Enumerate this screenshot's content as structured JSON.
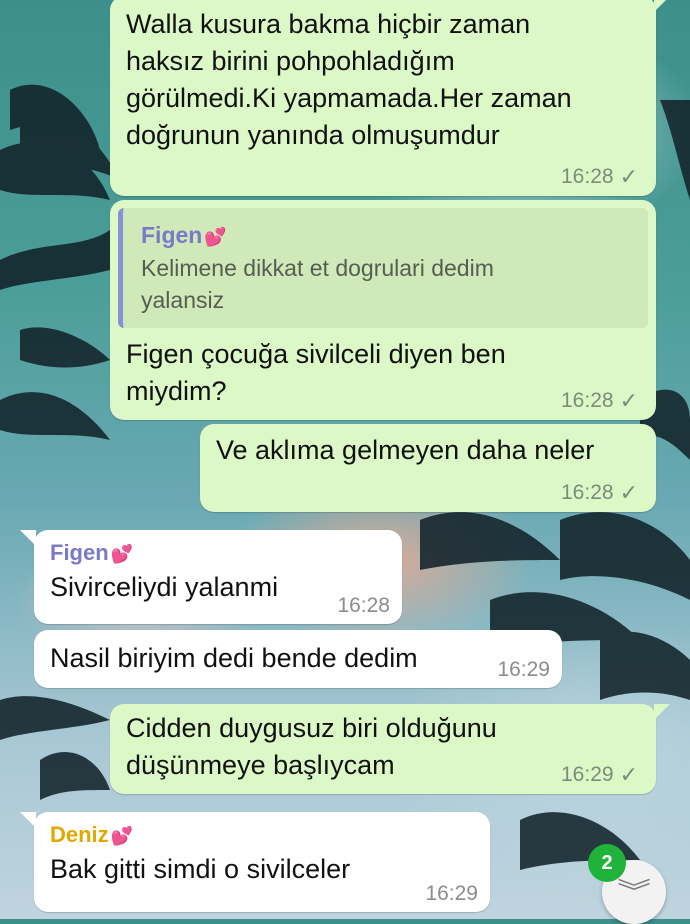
{
  "colors": {
    "outgoing_bubble": "#dcf8c6",
    "incoming_bubble": "#ffffff",
    "sender_figen": "#7b79c9",
    "sender_deniz": "#e0a800",
    "unread_badge": "#1fb33c"
  },
  "messages": [
    {
      "direction": "outgoing",
      "text": "Walla kusura bakma hiçbir zaman\nhaksız birini pohpohladığım\ngörülmedi.Ki yapmamada.Her zaman\ndoğrunun yanında olmuşumdur",
      "time": "16:28",
      "status_icon": "single-check"
    },
    {
      "direction": "outgoing",
      "reply_to": {
        "sender": "Figen",
        "text": "Kelimene dikkat et dogrulari dedim\nyalansiz"
      },
      "text": "Figen çocuğa sivilceli diyen ben\nmiydim?",
      "time": "16:28",
      "status_icon": "single-check"
    },
    {
      "direction": "outgoing",
      "text": "Ve aklıma gelmeyen daha neler",
      "time": "16:28",
      "status_icon": "single-check"
    },
    {
      "direction": "incoming",
      "sender": "Figen",
      "sender_emoji": "two-hearts-icon",
      "text": "Sivirceliydi yalanmi",
      "time": "16:28"
    },
    {
      "direction": "incoming",
      "text": "Nasil biriyim dedi bende dedim",
      "time": "16:29"
    },
    {
      "direction": "outgoing",
      "text": "Cidden duygusuz biri olduğunu\ndüşünmeye başlıycam",
      "time": "16:29",
      "status_icon": "single-check"
    },
    {
      "direction": "incoming",
      "sender": "Deniz",
      "sender_emoji": "two-hearts-icon",
      "text": "Bak gitti simdi o sivilceler",
      "time": "16:29"
    }
  ],
  "scroll_down": {
    "icon": "double-chevron-down-icon",
    "unread_count": "2"
  }
}
